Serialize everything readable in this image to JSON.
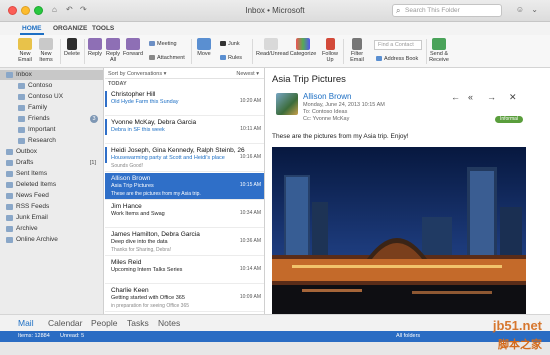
{
  "window": {
    "title": "Inbox • Microsoft"
  },
  "search": {
    "placeholder": "Search This Folder"
  },
  "ribbon_tabs": [
    "HOME",
    "ORGANIZE",
    "TOOLS"
  ],
  "ribbon": {
    "new_email": "New Email",
    "new_items": "New Items",
    "delete": "Delete",
    "reply": "Reply",
    "reply_all": "Reply All",
    "forward": "Forward",
    "meeting": "Meeting",
    "attachment": "Attachment",
    "move": "Move",
    "junk": "Junk",
    "rules": "Rules",
    "read_unread": "Read/Unread",
    "categorize": "Categorize",
    "follow_up": "Follow Up",
    "filter_email": "Filter Email",
    "find_contact": "Find a Contact",
    "address_book": "Address Book",
    "send_receive": "Send & Receive"
  },
  "folders": [
    {
      "label": "Inbox",
      "badge": "",
      "level": 0,
      "selected": true,
      "icon": "inbox-icon"
    },
    {
      "label": "Contoso",
      "badge": "",
      "level": 1,
      "icon": "folder-icon"
    },
    {
      "label": "Contoso UX",
      "badge": "",
      "level": 1,
      "icon": "folder-icon"
    },
    {
      "label": "Family",
      "badge": "",
      "level": 1,
      "icon": "folder-icon"
    },
    {
      "label": "Friends",
      "badge": "3",
      "level": 1,
      "icon": "folder-icon"
    },
    {
      "label": "Important",
      "badge": "",
      "level": 1,
      "icon": "folder-icon"
    },
    {
      "label": "Research",
      "badge": "",
      "level": 1,
      "icon": "folder-icon"
    },
    {
      "label": "Outbox",
      "badge": "",
      "level": 0,
      "icon": "outbox-icon"
    },
    {
      "label": "Drafts",
      "badge": "[1]",
      "level": 0,
      "plain": true,
      "icon": "drafts-icon"
    },
    {
      "label": "Sent Items",
      "badge": "",
      "level": 0,
      "icon": "sent-icon"
    },
    {
      "label": "Deleted Items",
      "badge": "",
      "level": 0,
      "icon": "trash-icon"
    },
    {
      "label": "News Feed",
      "badge": "",
      "level": 0,
      "icon": "folder-icon"
    },
    {
      "label": "RSS Feeds",
      "badge": "",
      "level": 0,
      "icon": "rss-icon"
    },
    {
      "label": "Junk Email",
      "badge": "",
      "level": 0,
      "icon": "junk-icon"
    },
    {
      "label": "Archive",
      "badge": "",
      "level": 0,
      "icon": "archive-icon"
    },
    {
      "label": "Online Archive",
      "badge": "",
      "level": 0,
      "icon": "archive-icon"
    }
  ],
  "message_list": {
    "sort_label": "Sort by Conversations ▾",
    "order_label": "Newest ▾",
    "group_today": "TODAY",
    "messages": [
      {
        "sender": "Christopher Hill",
        "subject": "Old Hyde Farm this Sunday",
        "preview": "",
        "time": "10:20 AM",
        "unread": true,
        "selected": false
      },
      {
        "sender": "Yvonne McKay, Debra Garcia",
        "subject": "Debra in SF this week",
        "preview": "",
        "time": "10:11 AM",
        "unread": true,
        "selected": false
      },
      {
        "sender": "Heidi Joseph, Gina Kennedy, Ralph Steinb, 26",
        "subject": "Housewarming party at Scott and Heidi's place",
        "preview": "Sounds Good!",
        "time": "10:16 AM",
        "unread": true,
        "selected": false
      },
      {
        "sender": "Allison Brown",
        "subject": "Asia Trip Pictures",
        "preview": "These are the pictures from my Asia trip.",
        "time": "10:15 AM",
        "unread": false,
        "selected": true
      },
      {
        "sender": "Jim Hance",
        "subject": "Work Items and Swag",
        "preview": "",
        "time": "10:34 AM",
        "unread": false,
        "selected": false
      },
      {
        "sender": "James Hamilton, Debra Garcia",
        "subject": "Deep dive into the data",
        "preview": "Thanks for Sharing, Debra!",
        "time": "10:36 AM",
        "unread": false,
        "selected": false
      },
      {
        "sender": "Miles Reid",
        "subject": "Upcoming Intern Talks Series",
        "preview": "",
        "time": "10:14 AM",
        "unread": false,
        "selected": false
      },
      {
        "sender": "Charlie Keen",
        "subject": "Getting started with Office 365",
        "preview": "in preparation for seeing Office 365",
        "time": "10:09 AM",
        "unread": false,
        "selected": false
      }
    ]
  },
  "reading": {
    "title": "Asia Trip Pictures",
    "sender": "Allison Brown",
    "date": "Monday, June 24, 2013 10:15 AM",
    "to": "To:  Contoso Ideas",
    "cc": "Cc:  Yvonne McKay",
    "tag": "Informal",
    "body": "These are the pictures from my Asia trip.   Enjoy!"
  },
  "nav": [
    "Mail",
    "Calendar",
    "People",
    "Tasks",
    "Notes"
  ],
  "status": {
    "items": "Items: 12884",
    "unread": "Unread: 5",
    "right": "All folders"
  },
  "watermark": {
    "site": "jb51.net",
    "cn": "脚本之家"
  }
}
